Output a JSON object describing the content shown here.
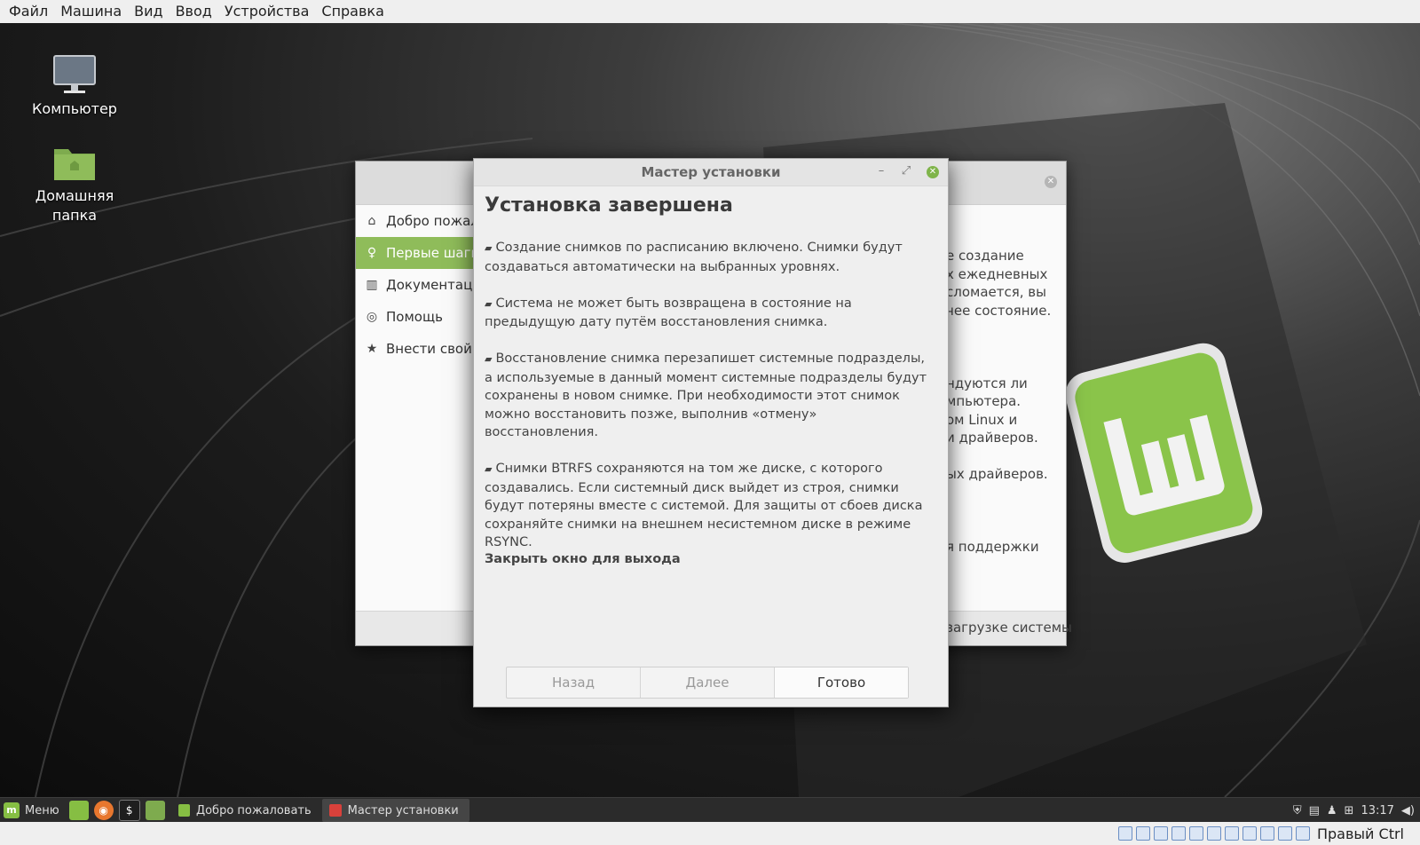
{
  "vbox_menu": [
    "Файл",
    "Машина",
    "Вид",
    "Ввод",
    "Устройства",
    "Справка"
  ],
  "desktop_icons": [
    {
      "label": "Компьютер",
      "icon": "computer-icon"
    },
    {
      "label": "Домашняя папка",
      "icon": "home-folder-icon"
    }
  ],
  "welcome": {
    "sidebar": [
      {
        "label": "Добро пожаловать",
        "icon": "home-icon"
      },
      {
        "label": "Первые шаги",
        "icon": "lightbulb-icon",
        "active": true
      },
      {
        "label": "Документация",
        "icon": "book-icon"
      },
      {
        "label": "Помощь",
        "icon": "lifebuoy-icon"
      },
      {
        "label": "Внести свой вклад",
        "icon": "star-icon"
      }
    ],
    "content_fragments": [
      "е создание",
      "х ежедневных",
      "сломается, вы",
      "чее состояние.",
      "",
      "",
      "",
      "ндуются ли",
      "мпьютера.",
      "ом Linux и",
      "и драйверов.",
      "",
      "ых драйверов.",
      "",
      "",
      "",
      "я поддержки"
    ],
    "footer_fragment": "загрузке системы",
    "accent": "#8fbc5a"
  },
  "wizard": {
    "title": "Мастер установки",
    "heading": "Установка завершена",
    "bullets": [
      "Создание снимков по расписанию включено. Снимки будут создаваться автоматически на выбранных уровнях.",
      "Система не может быть возвращена в состояние на предыдущую дату путём восстановления снимка.",
      "Восстановление снимка перезапишет системные подразделы, а используемые в данный момент системные подразделы будут сохранены в новом снимке. При необходимости этот снимок можно восстановить позже, выполнив «отмену» восстановления.",
      "Снимки BTRFS сохраняются на том же диске, с которого создавались. Если системный диск выйдет из строя, снимки будут потеряны вместе с системой. Для защиты от сбоев диска сохраняйте снимки на внешнем несистемном диске в режиме RSYNC."
    ],
    "close_hint": "Закрыть окно для выхода",
    "buttons": {
      "back": "Назад",
      "next": "Далее",
      "finish": "Готово"
    },
    "close_color": "#7fb44a"
  },
  "panel": {
    "menu_label": "Меню",
    "tasks": [
      {
        "label": "Добро пожаловать",
        "icon_color": "#86be43",
        "active": false
      },
      {
        "label": "Мастер установки",
        "icon_color": "#d9413b",
        "active": true
      }
    ],
    "clock": "13:17"
  },
  "vbox_status": {
    "host_key": "Правый Ctrl"
  }
}
